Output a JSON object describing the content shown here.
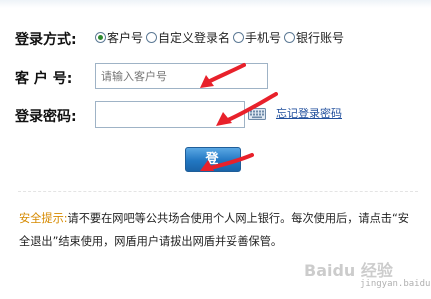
{
  "login_mode": {
    "label": "登录方式:",
    "options": [
      {
        "label": "客户号",
        "checked": true
      },
      {
        "label": "自定义登录名",
        "checked": false
      },
      {
        "label": "手机号",
        "checked": false
      },
      {
        "label": "银行账号",
        "checked": false
      }
    ]
  },
  "customer_no": {
    "label": "客 户 号:",
    "placeholder": "请输入客户号",
    "value": ""
  },
  "password": {
    "label": "登录密码:",
    "value": "",
    "keyboard_icon": "keyboard-icon",
    "forgot_link": "忘记登录密码"
  },
  "login_button": {
    "label": "登录"
  },
  "notice": {
    "label": "安全提示:",
    "text": "请不要在网吧等公共场合使用个人网上银行。每次使用后，请点击“安全退出”结束使用，网盾用户请拔出网盾并妥善保管。"
  },
  "watermark": {
    "text": "Baidu 经验",
    "sub": "jingyan.baidu.com"
  },
  "colors": {
    "annotation_arrow": "#e8212b",
    "button": "#2277c2",
    "notice_label": "#d68a00",
    "link": "#1f4e9c"
  }
}
